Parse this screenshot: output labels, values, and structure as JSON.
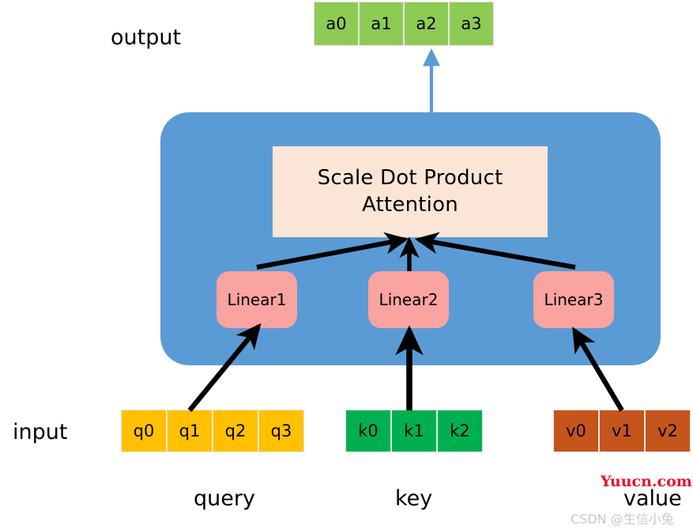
{
  "diagram": {
    "title_implicit": "Scaled Dot Product Attention with Linear projections",
    "labels": {
      "output": "output",
      "input": "input",
      "query": "query",
      "key": "key",
      "value": "value"
    },
    "attention_block": {
      "line1": "Scale Dot Product",
      "line2": "Attention",
      "fill": "#fbe5d6"
    },
    "container": {
      "fill": "#5b9bd5"
    },
    "linear_layers": [
      {
        "label": "Linear1",
        "fill": "#fba3a0"
      },
      {
        "label": "Linear2",
        "fill": "#fba3a0"
      },
      {
        "label": "Linear3",
        "fill": "#fba3a0"
      }
    ],
    "output_tokens": {
      "fill": "#8ecb54",
      "cells": [
        "a0",
        "a1",
        "a2",
        "a3"
      ]
    },
    "query_tokens": {
      "fill": "#ffc000",
      "cells": [
        "q0",
        "q1",
        "q2",
        "q3"
      ]
    },
    "key_tokens": {
      "fill": "#00b050",
      "cells": [
        "k0",
        "k1",
        "k2"
      ]
    },
    "value_tokens": {
      "fill": "#c5551b",
      "cells": [
        "v0",
        "v1",
        "v2"
      ]
    },
    "arrows": {
      "output_arrow_color": "#5b9bd5",
      "flow_arrow_color": "#000000"
    }
  },
  "watermarks": {
    "yuucn": "Yuucn.com",
    "csdn": "CSDN @生信小兔"
  }
}
